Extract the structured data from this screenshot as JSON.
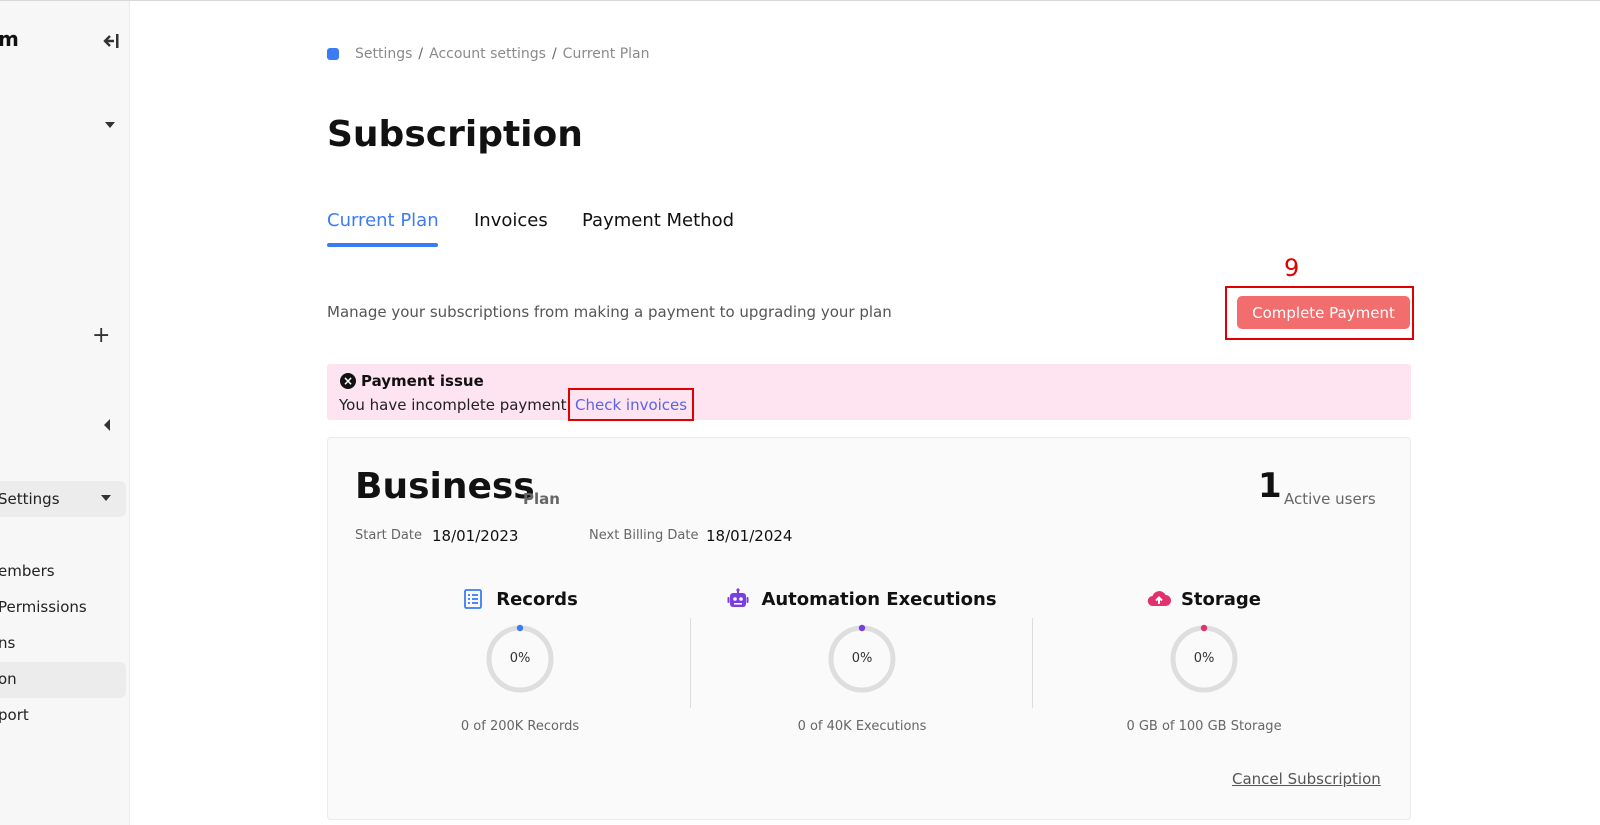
{
  "sidebar": {
    "brand": "m",
    "settings_label": "Settings",
    "items": [
      {
        "label": "embers"
      },
      {
        "label": "Permissions"
      },
      {
        "label": "ns"
      },
      {
        "label": "on"
      },
      {
        "label": "port"
      }
    ]
  },
  "breadcrumb": [
    "Settings",
    "Account settings",
    "Current Plan"
  ],
  "page": {
    "title": "Subscription",
    "tabs": [
      {
        "label": "Current Plan",
        "active": true
      },
      {
        "label": "Invoices",
        "active": false
      },
      {
        "label": "Payment Method",
        "active": false
      }
    ],
    "description": "Manage your subscriptions from making a payment to upgrading your plan",
    "annotation_number": "9",
    "complete_payment_label": "Complete Payment"
  },
  "alert": {
    "icon": "close-circle-icon",
    "title": "Payment issue",
    "message": "You have incomplete payment",
    "link_label": "Check invoices"
  },
  "plan": {
    "name": "Business",
    "plan_word": "Plan",
    "active_users_count": "1",
    "active_users_label": "Active users",
    "start_date_label": "Start Date",
    "start_date": "18/01/2023",
    "next_billing_label": "Next Billing Date",
    "next_billing_date": "18/01/2024",
    "metrics": [
      {
        "title": "Records",
        "icon": "list-icon",
        "percent_text": "0%",
        "percent": 0,
        "footer": "0 of 200K Records",
        "color": "#3b7cf4"
      },
      {
        "title": "Automation Executions",
        "icon": "robot-icon",
        "percent_text": "0%",
        "percent": 0,
        "footer": "0 of 40K Executions",
        "color": "#7a3ee0"
      },
      {
        "title": "Storage",
        "icon": "cloud-upload-icon",
        "percent_text": "0%",
        "percent": 0,
        "footer": "0 GB of 100 GB Storage",
        "color": "#e0336e"
      }
    ],
    "cancel_label": "Cancel Subscription"
  },
  "colors": {
    "accent": "#3b7cf4",
    "payment_button": "#f26d6d",
    "alert_bg": "#fde4f0",
    "annotation": "#e00000"
  }
}
